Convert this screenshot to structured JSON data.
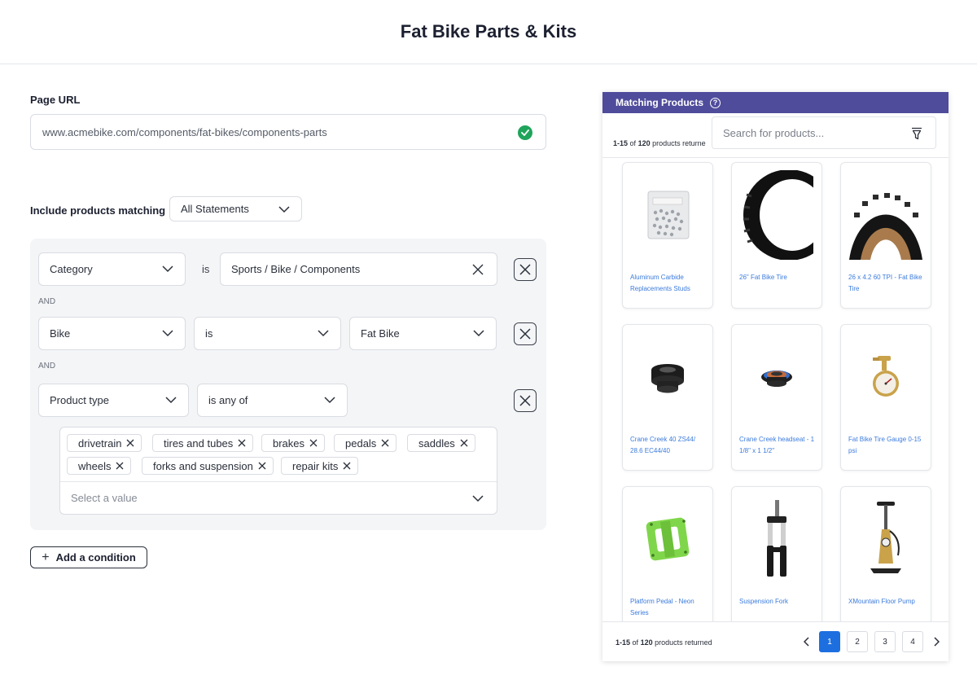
{
  "header": {
    "title": "Fat Bike Parts & Kits"
  },
  "page_url": {
    "label": "Page URL",
    "value": "www.acmebike.com/components/fat-bikes/components-parts",
    "status_icon": "check-circle-icon"
  },
  "matching": {
    "label": "Include products matching",
    "mode": "All Statements"
  },
  "conditions": [
    {
      "field": "Category",
      "operator": "is",
      "value": "Sports / Bike / Components"
    },
    {
      "field": "Bike",
      "operator": "is",
      "value": "Fat Bike"
    },
    {
      "field": "Product type",
      "operator": "is any of",
      "tags": [
        "drivetrain",
        "tires and tubes",
        "brakes",
        "pedals",
        "saddles",
        "wheels",
        "forks and suspension",
        "repair kits"
      ],
      "placeholder": "Select a value"
    }
  ],
  "connector": "AND",
  "add_condition": "Add a condition",
  "products_panel": {
    "title": "Matching Products",
    "range": "1-15",
    "of": "of",
    "total": "120",
    "returned_top": "products returne",
    "returned_bottom": "products returned",
    "search_placeholder": "Search for products...",
    "products": [
      {
        "name": "Aluminum Carbide Replacements Studs"
      },
      {
        "name": "26\" Fat Bike Tire"
      },
      {
        "name": "26 x 4.2 60 TPI - Fat Bike Tire"
      },
      {
        "name": "Crane Creek 40 ZS44/ 28.6 EC44/40"
      },
      {
        "name": "Crane Creek headseat - 1 1/8\" x 1 1/2\""
      },
      {
        "name": "Fat Bike Tire Gauge 0-15 psi"
      },
      {
        "name": "Platform Pedal - Neon Series"
      },
      {
        "name": "Suspension Fork"
      },
      {
        "name": "XMountain Floor Pump"
      }
    ],
    "pages": [
      "1",
      "2",
      "3",
      "4"
    ],
    "current_page": "1"
  },
  "colors": {
    "panel_header": "#4f4c9c",
    "accent": "#1d6fe0",
    "link": "#3b7bdc",
    "success": "#1fa45b"
  }
}
